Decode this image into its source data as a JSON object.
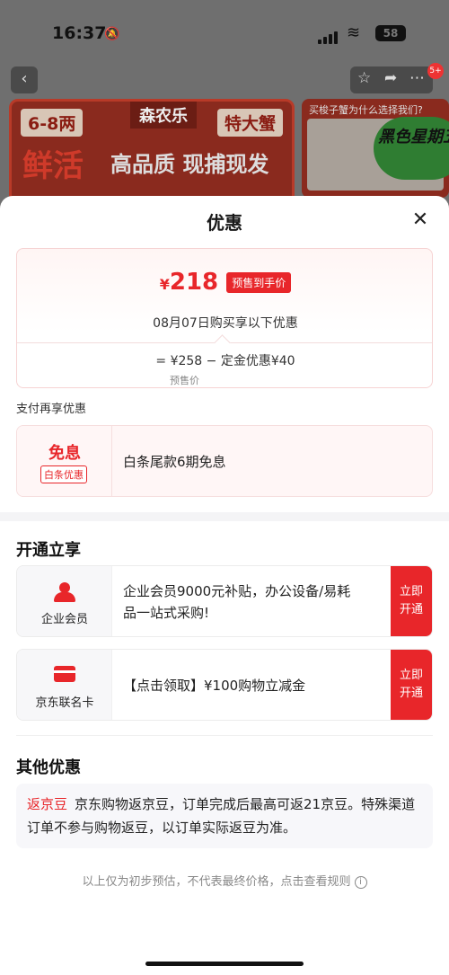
{
  "status": {
    "time": "16:37",
    "battery": "58"
  },
  "banner": {
    "tag_left": "6-8两",
    "brand": "森农乐",
    "tag_right": "特大蟹",
    "big": "鲜活",
    "slogan": "高品质 现捕现发",
    "side_title": "买梭子蟹为什么选择我们?",
    "side_badge": "黑色星期五",
    "nav_badge": "5+"
  },
  "sheet": {
    "title": "优惠",
    "price": {
      "symbol": "¥",
      "value": "218",
      "tag": "预售到手价",
      "note": "08月07日购买享以下优惠",
      "formula": "= ¥258 − 定金优惠¥40",
      "formula_sub": "预售价"
    },
    "pay_section_label": "支付再享优惠",
    "interest": {
      "title": "免息",
      "badge": "白条优惠",
      "text": "白条尾款6期免息"
    },
    "open_section_title": "开通立享",
    "enterprise": {
      "caption": "企业会员",
      "text_line1": "企业会员9000元补贴，办公设备/易耗",
      "text_line2": "品一站式采购!",
      "action": "立即开通",
      "icon": "person-icon"
    },
    "jd_card": {
      "caption": "京东联名卡",
      "text": "【点击领取】¥100购物立减金",
      "action": "立即开通",
      "icon": "card-icon"
    },
    "other_section_title": "其他优惠",
    "other": {
      "tag": "返京豆",
      "text": "京东购物返京豆，订单完成后最高可返21京豆。特殊渠道订单不参与购物返豆，以订单实际返豆为准。"
    },
    "footnote": "以上仅为初步预估，不代表最终价格，点击查看规则"
  },
  "colors": {
    "accent": "#e8262a"
  }
}
